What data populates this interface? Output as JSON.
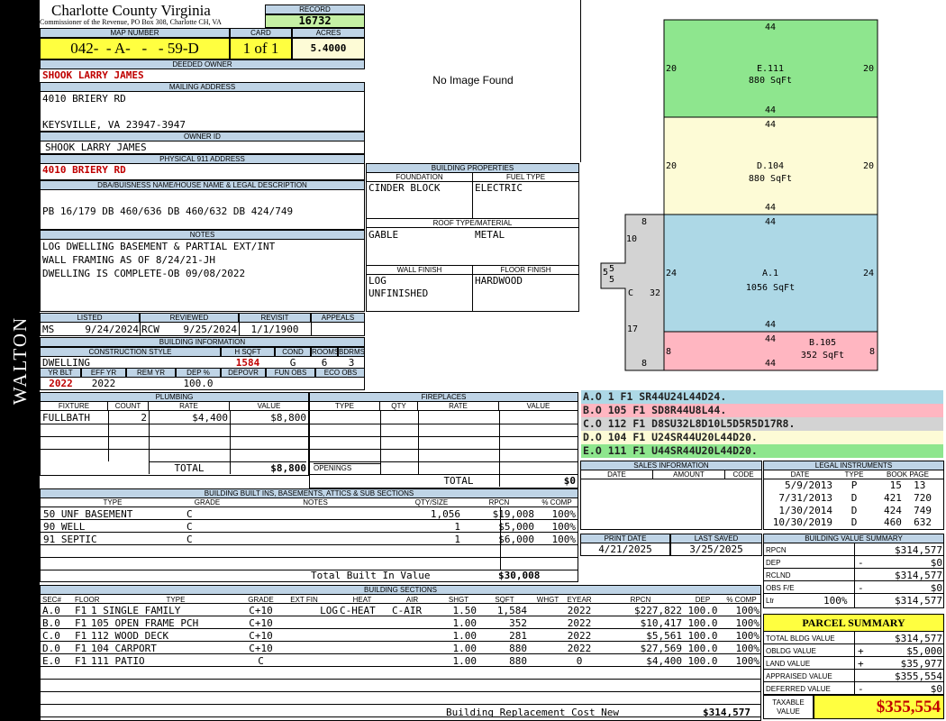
{
  "county": {
    "name": "Charlotte County Virginia",
    "sub": "Commissioner of the Revenue, PO Box 308, Charlotte CH, VA"
  },
  "side_label": "WALTON",
  "record": {
    "label": "RECORD",
    "value": "16732"
  },
  "map": {
    "label": "MAP NUMBER",
    "value": "042-  - A-   -   - 59-D"
  },
  "card": {
    "label": "CARD",
    "value": "1 of 1"
  },
  "acres": {
    "label": "ACRES",
    "value": "5.4000"
  },
  "owner": {
    "label": "DEEDED OWNER",
    "value": "SHOOK LARRY JAMES"
  },
  "mailing": {
    "label": "MAILING ADDRESS",
    "line1": "4010 BRIERY RD",
    "line2": "KEYSVILLE, VA 23947-3947"
  },
  "owner_id": {
    "label": "OWNER ID",
    "value": "SHOOK LARRY JAMES"
  },
  "physical": {
    "label": "PHYSICAL 911 ADDRESS",
    "value": "4010 BRIERY RD"
  },
  "legal": {
    "label": "DBA/BUISNESS NAME/HOUSE NAME & LEGAL DESCRIPTION",
    "value": "PB 16/179 DB 460/636 DB 460/632 DB 424/749"
  },
  "notes": {
    "label": "NOTES",
    "lines": [
      "LOG DWELLING BASEMENT & PARTIAL EXT/INT",
      "WALL FRAMING AS OF 8/24/21-JH",
      "DWELLING IS COMPLETE-OB 09/08/2022"
    ]
  },
  "listed": {
    "label": "LISTED",
    "code": "MS",
    "date": "9/24/2024"
  },
  "reviewed": {
    "label": "REVIEWED",
    "code": "RCW",
    "date": "9/25/2024"
  },
  "revisit": {
    "label": "REVISIT",
    "date": "1/1/1900"
  },
  "appeals": {
    "label": "APPEALS"
  },
  "building_info": {
    "label": "BUILDING INFORMATION",
    "h": [
      "CONSTRUCTION STYLE",
      "H SQFT",
      "COND",
      "ROOMS",
      "BDRMS"
    ],
    "v": [
      "DWELLING",
      "1584",
      "G",
      "6",
      "3"
    ],
    "h2": [
      "YR BLT",
      "EFF YR",
      "REM YR",
      "DEP %",
      "DEPOVR",
      "FUN OBS",
      "ECO OBS"
    ],
    "v2": [
      "2022",
      "2022",
      "",
      "100.0",
      "",
      "",
      ""
    ]
  },
  "no_image": "No Image Found",
  "props": {
    "label": "BUILDING PROPERTIES",
    "foundation_label": "FOUNDATION",
    "foundation": "CINDER BLOCK",
    "fuel_label": "FUEL TYPE",
    "fuel": "ELECTRIC",
    "roof_label": "ROOF TYPE/MATERIAL",
    "roof1": "GABLE",
    "roof2": "METAL",
    "wall_label": "WALL FINISH",
    "wall1": "LOG",
    "wall2": "UNFINISHED",
    "floor_label": "FLOOR FINISH",
    "floor": "HARDWOOD"
  },
  "sketch": {
    "e": {
      "label": "E.111",
      "sqft": "880 SqFt",
      "top": "44",
      "bottom": "44",
      "left": "20",
      "right": "20",
      "color": "#8ee68e"
    },
    "d": {
      "label": "D.104",
      "sqft": "880 SqFt",
      "top": "44",
      "bottom": "44",
      "left": "20",
      "right": "20",
      "color": "#fdfbd6"
    },
    "a": {
      "label": "A.1",
      "sqft": "1056 SqFt",
      "top": "44",
      "bottom": "44",
      "left": "24",
      "right": "24",
      "color": "#add8e6"
    },
    "b": {
      "label": "B.105",
      "sqft": "352 SqFt",
      "top": "44",
      "bottom": "44",
      "left": "8",
      "right": "8",
      "color": "#ffb6c1"
    },
    "c": {
      "label": "C",
      "dims": [
        "8",
        "10",
        "5",
        "5",
        "5",
        "32",
        "17",
        "8"
      ],
      "color": "#d3d3d3"
    }
  },
  "legend": [
    {
      "text": "A.O  1    F1  SR44U24L44D24.",
      "color": "#add8e6"
    },
    {
      "text": "B.O  105  F1  SD8R44U8L44.",
      "color": "#ffb6c1"
    },
    {
      "text": "C.O  112  F1  D8SU32L8D10L5D5R5D17R8.",
      "color": "#d3d3d3"
    },
    {
      "text": "D.O  104  F1  U24SR44U20L44D20.",
      "color": "#fdfbd6"
    },
    {
      "text": "E.O  111  F1  U44SR44U20L44D20.",
      "color": "#8ee68e"
    }
  ],
  "plumbing": {
    "label": "PLUMBING",
    "h": [
      "FIXTURE",
      "COUNT",
      "RATE",
      "VALUE"
    ],
    "rows": [
      [
        "FULLBATH",
        "2",
        "$4,400",
        "$8,800"
      ]
    ],
    "total_label": "TOTAL",
    "total": "$8,800"
  },
  "fireplaces": {
    "label": "FIREPLACES",
    "h": [
      "TYPE",
      "QTY",
      "RATE",
      "VALUE"
    ],
    "openings": "OPENINGS",
    "total_label": "TOTAL",
    "total": "$0"
  },
  "builtins": {
    "label": "BUILDING BUILT INS, BASEMENTS, ATTICS & SUB SECTIONS",
    "h": [
      "TYPE",
      "GRADE",
      "NOTES",
      "QTY/SIZE",
      "RPCN",
      "% COMP"
    ],
    "rows": [
      [
        "50 UNF BASEMENT",
        "C",
        "",
        "1,056",
        "$19,008",
        "100%"
      ],
      [
        "90 WELL",
        "C",
        "",
        "1",
        "$5,000",
        "100%"
      ],
      [
        "91 SEPTIC",
        "C",
        "",
        "1",
        "$6,000",
        "100%"
      ]
    ],
    "total_label": "Total Built In Value",
    "total": "$30,008"
  },
  "sales": {
    "label": "SALES INFORMATION",
    "h": [
      "DATE",
      "AMOUNT",
      "CODE"
    ]
  },
  "print": {
    "label": "PRINT DATE",
    "value": "4/21/2025"
  },
  "saved": {
    "label": "LAST SAVED",
    "value": "3/25/2025"
  },
  "instruments": {
    "label": "LEGAL INSTRUMENTS",
    "h": [
      "DATE",
      "TYPE",
      "BOOK PAGE"
    ],
    "rows": [
      [
        "5/9/2013",
        "P",
        "15  13"
      ],
      [
        "7/31/2013",
        "D",
        "421  720"
      ],
      [
        "1/30/2014",
        "D",
        "424  749"
      ],
      [
        "10/30/2019",
        "D",
        "460  632"
      ]
    ]
  },
  "sections": {
    "label": "BUILDING SECTIONS",
    "h": [
      "SEC#",
      "FLOOR",
      "TYPE",
      "GRADE",
      "EXT FIN",
      "HEAT",
      "AIR",
      "SHGT",
      "SQFT",
      "WHGT",
      "EYEAR",
      "RPCN",
      "DEP",
      "% COMP"
    ],
    "rows": [
      [
        "A.0",
        "F1",
        "1 SINGLE FAMILY",
        "C+10",
        "LOG",
        "C-HEAT",
        "C-AIR",
        "1.50",
        "1,584",
        "",
        "2022",
        "$227,822",
        "100.0",
        "100%"
      ],
      [
        "B.0",
        "F1",
        "105 OPEN FRAME PCH",
        "C+10",
        "",
        "",
        "",
        "1.00",
        "352",
        "",
        "2022",
        "$10,417",
        "100.0",
        "100%"
      ],
      [
        "C.0",
        "F1",
        "112 WOOD DECK",
        "C+10",
        "",
        "",
        "",
        "1.00",
        "281",
        "",
        "2022",
        "$5,561",
        "100.0",
        "100%"
      ],
      [
        "D.0",
        "F1",
        "104 CARPORT",
        "C+10",
        "",
        "",
        "",
        "1.00",
        "880",
        "",
        "2022",
        "$27,569",
        "100.0",
        "100%"
      ],
      [
        "E.0",
        "F1",
        "111 PATIO",
        "C",
        "",
        "",
        "",
        "1.00",
        "880",
        "",
        "0",
        "$4,400",
        "100.0",
        "100%"
      ]
    ],
    "total_label": "Building Replacement Cost New",
    "total": "$314,577"
  },
  "bvs": {
    "label": "BUILDING VALUE SUMMARY",
    "rows": [
      [
        "RPCN",
        "",
        "",
        "$314,577"
      ],
      [
        "DEP",
        "",
        "-",
        "$0"
      ],
      [
        "RCLND",
        "",
        "",
        "$314,577"
      ],
      [
        "OBS F/E",
        "",
        "-",
        "$0"
      ],
      [
        "Ltr",
        "100%",
        "",
        "$314,577"
      ]
    ]
  },
  "parcel": {
    "label": "PARCEL SUMMARY",
    "rows": [
      [
        "TOTAL BLDG VALUE",
        "",
        "$314,577"
      ],
      [
        "OBLDG VALUE",
        "+",
        "$5,000"
      ],
      [
        "LAND VALUE",
        "+",
        "$35,977"
      ],
      [
        "APPRAISED VALUE",
        "",
        "$355,554"
      ],
      [
        "DEFERRED VALUE",
        "-",
        "$0"
      ]
    ],
    "taxable_label1": "TAXABLE",
    "taxable_label2": "VALUE",
    "taxable": "$355,554"
  }
}
